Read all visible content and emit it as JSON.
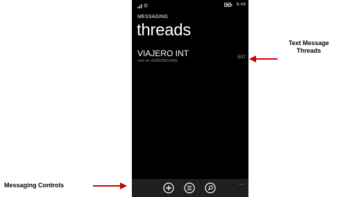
{
  "status_bar": {
    "time": "8:48",
    "signal_icon": "signal-icon",
    "data_icon": "data-icon",
    "battery_icon": "battery-icon"
  },
  "header": {
    "app_title": "MESSAGING",
    "page_title": "threads"
  },
  "threads": [
    {
      "name": "VIAJERO INT",
      "preview": "osto al +525525813300",
      "date": "5/17"
    }
  ],
  "app_bar": {
    "buttons": [
      {
        "name": "new-message",
        "icon": "plus-icon"
      },
      {
        "name": "select",
        "icon": "list-icon"
      },
      {
        "name": "search",
        "icon": "search-icon"
      }
    ],
    "more": "..."
  },
  "annotations": {
    "right_label": "Text Message Threads",
    "left_label": "Messaging Controls",
    "arrow_color": "#cc0000"
  }
}
